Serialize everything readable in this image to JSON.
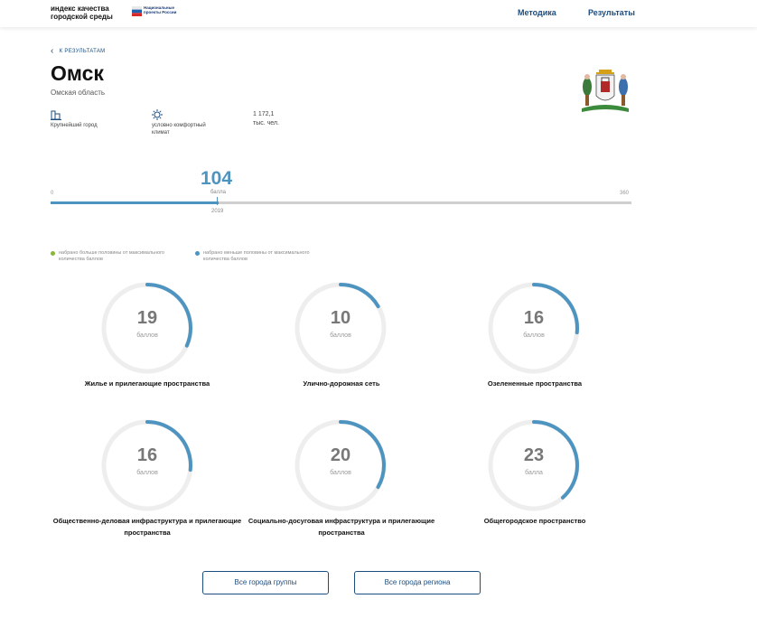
{
  "header": {
    "brand": "индекс качества городской среды",
    "partner": "Национальные проекты России",
    "nav": [
      "Методика",
      "Результаты"
    ]
  },
  "back_label": "К РЕЗУЛЬТАТАМ",
  "city": {
    "name": "Омск",
    "region": "Омская область",
    "facts": [
      {
        "icon": "city-building-icon",
        "label": "Крупнейший город"
      },
      {
        "icon": "climate-sun-icon",
        "label": "условно комфортный климат"
      },
      {
        "icon": "",
        "label": "1 172,1\nтыс. чел."
      }
    ]
  },
  "score": {
    "value": "104",
    "unit": "балла",
    "min": "0",
    "max": "360",
    "year": "2019",
    "value_num": 104,
    "max_num": 360
  },
  "legend": [
    {
      "color": "#8ab53d",
      "text": "набрано больше половины от максимального количества баллов"
    },
    {
      "color": "#4e94c0",
      "text": "набрано меньше половины от максимального количества баллов"
    }
  ],
  "categories": [
    {
      "value": "19",
      "unit": "баллов",
      "label": "Жилье и прилегающие пространства",
      "score": 19,
      "max": 60
    },
    {
      "value": "10",
      "unit": "баллов",
      "label": "Улично-дорожная сеть",
      "score": 10,
      "max": 60
    },
    {
      "value": "16",
      "unit": "баллов",
      "label": "Озелененные пространства",
      "score": 16,
      "max": 60
    },
    {
      "value": "16",
      "unit": "баллов",
      "label": "Общественно-деловая инфраструктура и прилегающие пространства",
      "score": 16,
      "max": 60
    },
    {
      "value": "20",
      "unit": "баллов",
      "label": "Социально-досуговая инфраструктура и прилегающие пространства",
      "score": 20,
      "max": 60
    },
    {
      "value": "23",
      "unit": "балла",
      "label": "Общегородское пространство",
      "score": 23,
      "max": 60
    }
  ],
  "buttons": [
    "Все города группы",
    "Все города региона"
  ],
  "colors": {
    "accent": "#4e94c0",
    "link": "#1a4d80",
    "track": "#eeeeee"
  }
}
